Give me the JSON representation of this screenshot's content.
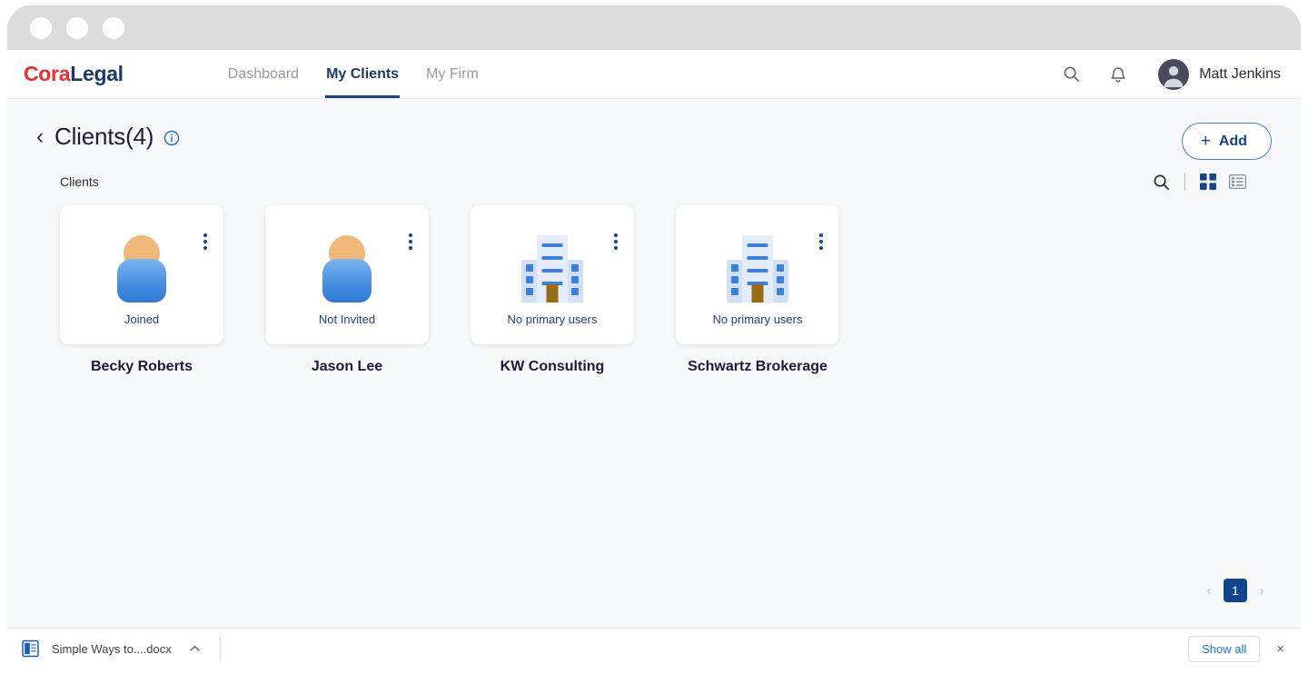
{
  "window": {
    "dots": [
      "close-dot",
      "minimize-dot",
      "maximize-dot"
    ]
  },
  "appbar": {
    "logo_first": "Cora",
    "logo_second": "Legal",
    "nav": [
      {
        "label": "Dashboard",
        "active": false
      },
      {
        "label": "My Clients",
        "active": true
      },
      {
        "label": "My Firm",
        "active": false
      }
    ],
    "search_icon": "search-icon",
    "bell_icon": "notification-bell-icon",
    "user_name": "Matt Jenkins",
    "avatar_icon": "user-avatar"
  },
  "page": {
    "back_chevron": "‹",
    "title": "Clients(4)",
    "info_icon": "info-icon",
    "add_label": "Add",
    "add_plus": "+",
    "section_label": "Clients",
    "tool_search_icon": "search-icon",
    "tool_grid_icon": "grid-view-icon",
    "tool_list_icon": "list-view-icon"
  },
  "cards": [
    {
      "name": "Becky Roberts",
      "status": "Joined",
      "type": "person"
    },
    {
      "name": "Jason Lee",
      "status": "Not Invited",
      "type": "person"
    },
    {
      "name": "KW Consulting",
      "status": "No primary users",
      "type": "building"
    },
    {
      "name": "Schwartz Brokerage",
      "status": "No primary users",
      "type": "building"
    }
  ],
  "pagination": {
    "prev": "‹",
    "current": "1",
    "next": "›"
  },
  "downloads": {
    "file_name": "Simple Ways to....docx",
    "file_icon": "word-document-icon",
    "caret": "⌃",
    "show_all": "Show all",
    "close": "×"
  },
  "colors": {
    "brand_red": "#ef2b2d",
    "brand_navy": "#1b3a6b",
    "accent_blue": "#17458c",
    "status_text": "#24407a"
  }
}
